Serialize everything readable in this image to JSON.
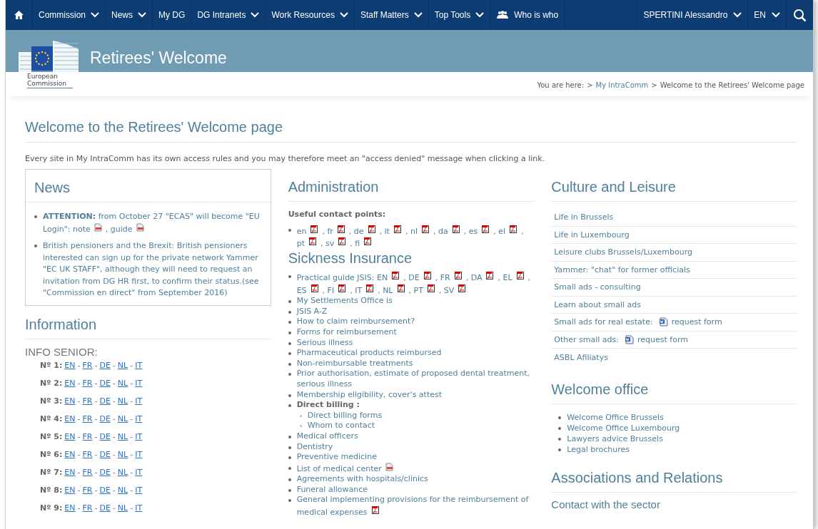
{
  "nav": {
    "items": [
      {
        "kind": "home"
      },
      {
        "kind": "text",
        "label": "Commission",
        "dropdown": true
      },
      {
        "kind": "text",
        "label": "News",
        "dropdown": true
      },
      {
        "kind": "text",
        "label": "My DG",
        "dropdown": false
      },
      {
        "kind": "text",
        "label": "DG Intranets",
        "dropdown": true
      },
      {
        "kind": "text",
        "label": "Work Resources",
        "dropdown": true
      },
      {
        "kind": "text",
        "label": "Staff Matters",
        "dropdown": true
      },
      {
        "kind": "text",
        "label": "Top Tools",
        "dropdown": true
      },
      {
        "kind": "people",
        "label": "Who is who",
        "dropdown": false
      }
    ],
    "right": [
      {
        "label": "SPERTINI Alessandro",
        "dropdown": true
      },
      {
        "label": "EN",
        "dropdown": true
      }
    ]
  },
  "banner": {
    "title": "Retirees' Welcome",
    "logo_caption": "European Commission"
  },
  "breadcrumb": {
    "prefix": "You are here:",
    "separator": ">",
    "items": [
      "My IntraComm",
      "Welcome to the Retirees' Welcome page"
    ]
  },
  "page_title": "Welcome to the Retirees' Welcome page",
  "notice": "Every site in My IntraComm has its own access rules and you may therefore meet an \"access denied\" message when clicking a link.",
  "news": {
    "title": "News",
    "items": [
      {
        "text": "**ATTENTION:** from October 27 \"ECAS\" will become \"EU Login\":",
        "separator": ",",
        "links": [
          {
            "text": "note",
            "kind": "doc"
          },
          {
            "text": "guide",
            "kind": "doc"
          }
        ]
      },
      {
        "text": "British pensioners and the Brexit: British pensioners interested can sign up for the private network Yammer \"EC UK STAFF\", although they will need to request an invitation from DG HR first, to confirm their status.(see \"Commission en direct\" from September 2016)"
      }
    ]
  },
  "information": {
    "title": "Information",
    "subtitle": "INFO SENIOR:",
    "rows": [
      {
        "label": "Nº 1:",
        "links": [
          "EN",
          "FR",
          "DE",
          "NL",
          "IT"
        ],
        "separator": "-"
      },
      {
        "label": "Nº 2:",
        "links": [
          "EN",
          "FR",
          "DE",
          "NL",
          "IT"
        ],
        "separator": "-"
      },
      {
        "label": "Nº 3:",
        "links": [
          "EN",
          "FR",
          "DE",
          "NL",
          "IT"
        ],
        "separator": "-"
      },
      {
        "label": "Nº 4:",
        "links": [
          "EN",
          "FR",
          "DE",
          "NL",
          "IT"
        ],
        "separator": "-"
      },
      {
        "label": "Nº 5:",
        "links": [
          "EN",
          "FR",
          "DE",
          "NL",
          "IT"
        ],
        "separator": "-"
      },
      {
        "label": "Nº 6:",
        "links": [
          "EN",
          "FR",
          "DE",
          "NL",
          "IT"
        ],
        "separator": "-"
      },
      {
        "label": "Nº 7:",
        "links": [
          "EN",
          "FR",
          "DE",
          "NL",
          "IT"
        ],
        "separator": "-"
      },
      {
        "label": "Nº 8:",
        "links": [
          "EN",
          "FR",
          "DE",
          "NL",
          "IT"
        ],
        "separator": "-"
      },
      {
        "label": "Nº 9:",
        "links": [
          "EN",
          "FR",
          "DE",
          "NL",
          "IT"
        ],
        "separator": "-"
      }
    ]
  },
  "administration": {
    "title": "Administration",
    "label": "Useful contact points:",
    "items": [
      {
        "separator": ",",
        "links": [
          {
            "text": "en",
            "kind": "pdf"
          },
          {
            "text": "fr",
            "kind": "pdf"
          },
          {
            "text": "de",
            "kind": "pdf"
          },
          {
            "text": "it",
            "kind": "pdf"
          },
          {
            "text": "nl",
            "kind": "pdf"
          },
          {
            "text": "da",
            "kind": "pdf"
          },
          {
            "text": "es",
            "kind": "pdf"
          },
          {
            "text": "el",
            "kind": "pdf"
          },
          {
            "text": "pt",
            "kind": "pdf"
          },
          {
            "text": "sv",
            "kind": "pdf"
          },
          {
            "text": "fi",
            "kind": "pdf"
          }
        ]
      }
    ]
  },
  "sickness": {
    "title": "Sickness Insurance",
    "items": [
      {
        "text": "Practical guide JSIS:",
        "separator": ",",
        "links": [
          {
            "text": "EN",
            "kind": "pdf"
          },
          {
            "text": "DE",
            "kind": "pdf"
          },
          {
            "text": "FR",
            "kind": "pdf"
          },
          {
            "text": "DA",
            "kind": "pdf"
          },
          {
            "text": "EL",
            "kind": "pdf"
          },
          {
            "text": "ES",
            "kind": "pdf"
          },
          {
            "text": "FI",
            "kind": "pdf"
          },
          {
            "text": "IT",
            "kind": "pdf"
          },
          {
            "text": "NL",
            "kind": "pdf"
          },
          {
            "text": "PT",
            "kind": "pdf"
          },
          {
            "text": "SV",
            "kind": "pdf"
          }
        ]
      },
      {
        "text": "My Settlements Office is"
      },
      {
        "text": "JSIS A-Z"
      },
      {
        "text": "How to claim reimbursement?"
      },
      {
        "text": "Forms for reimbursement"
      },
      {
        "text": "Serious illness"
      },
      {
        "text": "Pharmaceutical products reimbursed"
      },
      {
        "text": "Non-reimbursable treatments"
      },
      {
        "text": "Prior authorisation, estimate of proposed dental treatment, serious illness"
      },
      {
        "text": "Membership eligibility, cover's attest"
      },
      {
        "text": "Direct billing :",
        "bold": true,
        "children": [
          {
            "text": "Direct billing forms"
          },
          {
            "text": "Whom to contact"
          }
        ]
      },
      {
        "text": "Medical officers"
      },
      {
        "text": "Dentistry"
      },
      {
        "text": "Preventive medicine"
      },
      {
        "text": "List of medical center",
        "kind": "doc"
      },
      {
        "text": "Agreements with hospitals/clinics"
      },
      {
        "text": "Funeral allowance"
      },
      {
        "text": "General implementing provisions for the reimbursement of medical expenses",
        "kind": "pdf"
      }
    ]
  },
  "culture": {
    "title": "Culture and Leisure",
    "items": [
      {
        "text": "Life in Brussels"
      },
      {
        "text": "Life in Luxembourg"
      },
      {
        "text": "Leisure clubs Brussels/Luxembourg"
      },
      {
        "text": "Yammer: \"chat\" for former officials"
      },
      {
        "text": "Small ads - consulting"
      },
      {
        "text": "Learn about small ads"
      },
      {
        "text": "Small ads for real estate:",
        "form": {
          "text": "request form",
          "kind": "word"
        }
      },
      {
        "text": "Other small ads:",
        "form": {
          "text": "request form",
          "kind": "word"
        }
      },
      {
        "text": "ASBL Afiliatys"
      }
    ]
  },
  "welcome_office": {
    "title": "Welcome office",
    "items": [
      {
        "text": "Welcome Office Brussels"
      },
      {
        "text": "Welcome Office Luxembourg"
      },
      {
        "text": "Lawyers advice Brussels"
      },
      {
        "text": "Legal brochures"
      }
    ]
  },
  "associations": {
    "title": "Associations and Relations",
    "items": [
      {
        "text": "Contact with the sector"
      }
    ]
  }
}
